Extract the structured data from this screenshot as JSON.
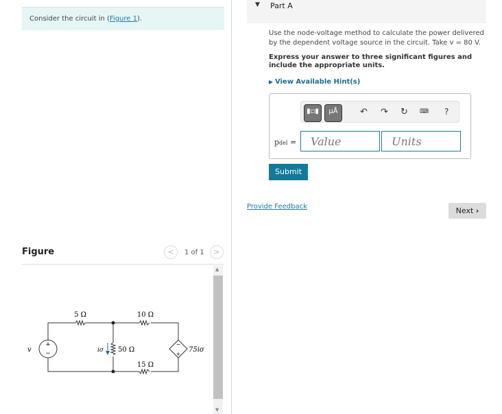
{
  "intro": {
    "text": "Consider the circuit in ",
    "link": "Figure 1",
    "after": ")."
  },
  "figure": {
    "title": "Figure",
    "pager": "1 of 1",
    "prev": "<",
    "next": ">",
    "circuit": {
      "r1": "5 Ω",
      "r2": "10 Ω",
      "r3": "50 Ω",
      "r4": "15 Ω",
      "source": "v",
      "current": "iσ",
      "dependent": "75iσ"
    }
  },
  "part": {
    "title": "Part A",
    "question": "Use the node-voltage method to calculate the power delivered by the dependent voltage source in the circuit. Take v = 80 V.",
    "instructions": "Express your answer to three significant figures and include the appropriate units.",
    "hint": "View Available Hint(s)",
    "toolbar": {
      "units_btn": "μÅ",
      "help": "?"
    },
    "answer_label": "p",
    "answer_sub": "del",
    "equals": "=",
    "value_placeholder": "Value",
    "units_placeholder": "Units",
    "submit": "Submit"
  },
  "footer": {
    "feedback": "Provide Feedback",
    "next": "Next"
  }
}
